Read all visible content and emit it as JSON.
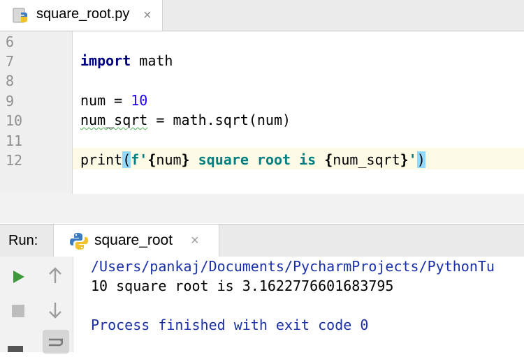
{
  "tab": {
    "filename": "square_root.py",
    "close": "×"
  },
  "editor": {
    "line_numbers": [
      "6",
      "7",
      "8",
      "9",
      "10",
      "11",
      "12"
    ],
    "code": {
      "l7_kw": "import",
      "l7_rest": " math",
      "l9_a": "num = ",
      "l9_num": "10",
      "l10_var": "num_sqrt",
      "l10_rest": " = math.sqrt(num)",
      "l12_print": "print",
      "l12_open": "(",
      "l12_fprefix": "f'",
      "l12_b1": "{",
      "l12_v1": "num",
      "l12_b2": "}",
      "l12_text": " square root is ",
      "l12_b3": "{",
      "l12_v2": "num_sqrt",
      "l12_b4": "}",
      "l12_q": "'",
      "l12_close": ")"
    }
  },
  "run": {
    "label": "Run:",
    "tab_label": "square_root",
    "tab_close": "×",
    "output": [
      "/Users/pankaj/Documents/PycharmProjects/PythonTu",
      "10 square root is 3.1622776601683795",
      "",
      "Process finished with exit code 0"
    ]
  },
  "icons": [
    "python-file-icon",
    "close-icon",
    "play-icon",
    "stop-icon",
    "arrow-up-icon",
    "arrow-down-icon",
    "soft-wrap-icon"
  ],
  "colors": {
    "keyword": "#000080",
    "number": "#1f00ff",
    "fstring": "#008080",
    "console_link": "#1a2fa8",
    "run_green": "#3c9a3c"
  }
}
